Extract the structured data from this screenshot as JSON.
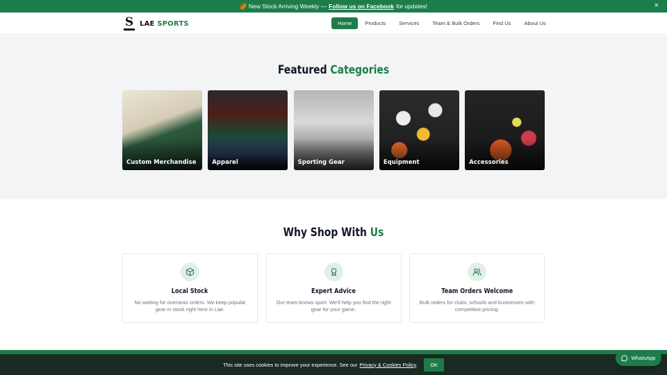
{
  "announcement": {
    "ball_icon": "🏉",
    "prefix": "New Stock Arriving Weekly —",
    "link_text": "Follow us on Facebook",
    "suffix": "for updates!",
    "close_icon": "×"
  },
  "header": {
    "logo_mark": "S",
    "logo_word_1": "LAE",
    "logo_word_2": "SPORTS",
    "nav": [
      {
        "label": "Home",
        "active": true
      },
      {
        "label": "Products"
      },
      {
        "label": "Services"
      },
      {
        "label": "Team & Bulk Orders"
      },
      {
        "label": "Find Us"
      },
      {
        "label": "About Us"
      }
    ]
  },
  "featured": {
    "title_plain": "Featured",
    "title_accent": "Categories",
    "cards": [
      {
        "label": "Custom Merchandise"
      },
      {
        "label": "Apparel"
      },
      {
        "label": "Sporting Gear"
      },
      {
        "label": "Equipment"
      },
      {
        "label": "Accessories"
      }
    ]
  },
  "why": {
    "title_plain": "Why Shop With",
    "title_accent": "Us",
    "features": [
      {
        "icon": "box-icon",
        "title": "Local Stock",
        "description": "No waiting for overseas orders. We keep popular gear in stock right here in Lae."
      },
      {
        "icon": "award-icon",
        "title": "Expert Advice",
        "description": "Our team knows sport. We'll help you find the right gear for your game."
      },
      {
        "icon": "users-icon",
        "title": "Team Orders Welcome",
        "description": "Bulk orders for clubs, schools and businesses with competitive pricing."
      }
    ]
  },
  "cookie": {
    "text": "This site uses cookies to improve your experience. See our",
    "policy_link": "Privacy & Cookies Policy",
    "period": ".",
    "ok_label": "OK"
  },
  "whatsapp": {
    "label": "WhatsApp"
  },
  "colors": {
    "brand_green": "#1d7d4a",
    "cookie_bg": "#1a2a22",
    "section_bg": "#f3f4f5"
  }
}
